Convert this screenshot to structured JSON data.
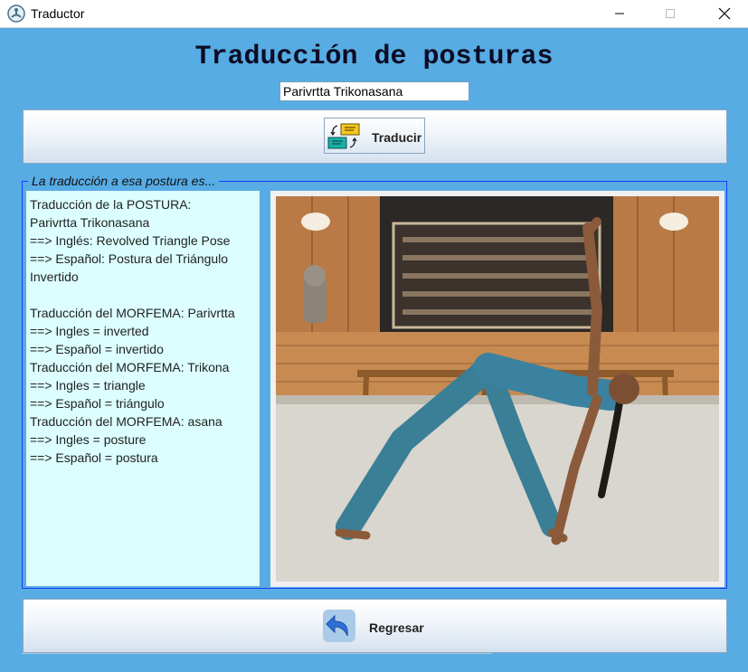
{
  "window": {
    "title": "Traductor",
    "icon": "yoga-figure-icon"
  },
  "header": {
    "title": "Traducción de posturas"
  },
  "search": {
    "value": "Parivrtta Trikonasana"
  },
  "translate_button": {
    "label": "Traducir",
    "icon": "translate-dialog-icon"
  },
  "result": {
    "legend": "La traducción a esa postura es...",
    "text": "Traducción de la POSTURA:\nParivrtta Trikonasana\n==> Inglés: Revolved Triangle Pose\n==> Español: Postura del Triángulo Invertido\n\nTraducción del MORFEMA: Parivrtta\n==> Ingles = inverted\n==> Español = invertido\nTraducción del MORFEMA: Trikona\n==> Ingles = triangle\n==> Español = triángulo\nTraducción del MORFEMA: asana\n==> Ingles = posture\n==> Español = postura"
  },
  "back_button": {
    "label": "Regresar",
    "icon": "back-arrow-icon"
  },
  "colors": {
    "background": "#58ace4",
    "result_background": "#dcfefe",
    "panel_border": "#1a3cff"
  }
}
